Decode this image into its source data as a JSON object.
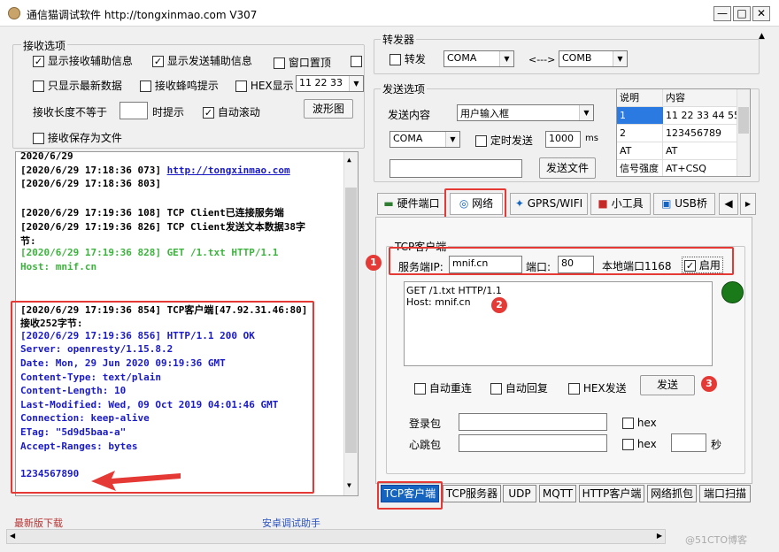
{
  "window": {
    "title": "通信猫调试软件  http://tongxinmao.com   V307",
    "min": "—",
    "max": "□",
    "close": "✕"
  },
  "recv": {
    "group_label": "接收选项",
    "show_recv_aux": "显示接收辅助信息",
    "show_send_aux": "显示发送辅助信息",
    "window_top": "窗口置顶",
    "only_latest": "只显示最新数据",
    "recv_beep": "接收蜂鸣提示",
    "hex_show": "HEX显示",
    "hex_sample": "11 22 33",
    "len_label": "接收长度不等于",
    "len_value": "",
    "len_hint": "时提示",
    "auto_scroll": "自动滚动",
    "wave_button": "波形图",
    "save_file": "接收保存为文件"
  },
  "log": [
    {
      "text": "2020/6/29",
      "color": "#000000"
    },
    {
      "text": "[2020/6/29 17:18:36 073]",
      "color": "#000000",
      "link": "http://tongxinmao.com"
    },
    {
      "text": "[2020/6/29 17:18:36 803]",
      "color": "#000000"
    },
    {
      "text": "",
      "color": "#000000"
    },
    {
      "text": "[2020/6/29 17:19:36 108]  TCP Client已连接服务端",
      "color": "#000000"
    },
    {
      "text": "[2020/6/29 17:19:36 826]  TCP Client发送文本数据38字",
      "color": "#000000"
    },
    {
      "text": "节:",
      "color": "#000000"
    },
    {
      "text": "[2020/6/29 17:19:36 828]  GET /1.txt HTTP/1.1",
      "color": "#3cb33c"
    },
    {
      "text": "Host: mnif.cn",
      "color": "#3cb33c"
    },
    {
      "text": "",
      "color": "#000000"
    },
    {
      "text": "",
      "color": "#000000"
    },
    {
      "text": "[2020/6/29 17:19:36 854]  TCP客户端[47.92.31.46:80]",
      "color": "#000000"
    },
    {
      "text": "接收252字节:",
      "color": "#000000"
    },
    {
      "text": "[2020/6/29 17:19:36 856]  HTTP/1.1 200 OK",
      "color": "#1a1ac8"
    },
    {
      "text": "Server: openresty/1.15.8.2",
      "color": "#1a1ac8"
    },
    {
      "text": "Date: Mon, 29 Jun 2020 09:19:36 GMT",
      "color": "#1a1ac8"
    },
    {
      "text": "Content-Type: text/plain",
      "color": "#1a1ac8"
    },
    {
      "text": "Content-Length: 10",
      "color": "#1a1ac8"
    },
    {
      "text": "Last-Modified: Wed, 09 Oct 2019 04:01:46 GMT",
      "color": "#1a1ac8"
    },
    {
      "text": "Connection: keep-alive",
      "color": "#1a1ac8"
    },
    {
      "text": "ETag: \"5d9d5baa-a\"",
      "color": "#1a1ac8"
    },
    {
      "text": "Accept-Ranges: bytes",
      "color": "#1a1ac8"
    },
    {
      "text": "",
      "color": "#000000"
    },
    {
      "text": "1234567890",
      "color": "#1a1ac8"
    }
  ],
  "footer": {
    "latest_download": "最新版下载",
    "android_helper": "安卓调试助手",
    "watermark": "@51CTO博客"
  },
  "forward": {
    "group_label": "转发器",
    "forward_label": "转发",
    "com_a": "COMA",
    "arrow": "<--->",
    "com_b": "COMB"
  },
  "send": {
    "group_label": "发送选项",
    "content_label": "发送内容",
    "content_select": "用户输入框",
    "com_select": "COMA",
    "timed_send": "定时发送",
    "interval": "1000",
    "unit": "ms",
    "file_input": "",
    "send_file_button": "发送文件",
    "table_headers": [
      "说明",
      "内容"
    ],
    "table_rows": [
      {
        "desc": "1",
        "content": "11 22 33 44 55"
      },
      {
        "desc": "2",
        "content": "123456789"
      },
      {
        "desc": "AT",
        "content": "AT"
      },
      {
        "desc": "信号强度",
        "content": "AT+CSQ"
      }
    ]
  },
  "tabs": [
    "硬件端口",
    "网络",
    "GPRS/WIFI",
    "小工具",
    "USB桥"
  ],
  "tcp": {
    "group_label": "TCP客户端",
    "server_ip_label": "服务端IP:",
    "server_ip": "mnif.cn",
    "port_label": "端口:",
    "port": "80",
    "local_port_label": "本地端口",
    "local_port": "1168",
    "enable_label": "启用",
    "message_lines": [
      "GET /1.txt HTTP/1.1",
      "Host: mnif.cn"
    ],
    "auto_reconnect": "自动重连",
    "auto_reply": "自动回复",
    "hex_send": "HEX发送",
    "send_button": "发送",
    "login_label": "登录包",
    "heartbeat_label": "心跳包",
    "hex_label": "hex",
    "seconds_label": "秒",
    "status_color": "#1a7a1a"
  },
  "bottom_tabs": [
    "TCP客户端",
    "TCP服务器",
    "UDP",
    "MQTT",
    "HTTP客户端",
    "网络抓包",
    "端口扫描"
  ],
  "badges": [
    "1",
    "2",
    "3"
  ],
  "colors": {
    "highlight": "#e53935",
    "active_tab": "#1565c0"
  }
}
